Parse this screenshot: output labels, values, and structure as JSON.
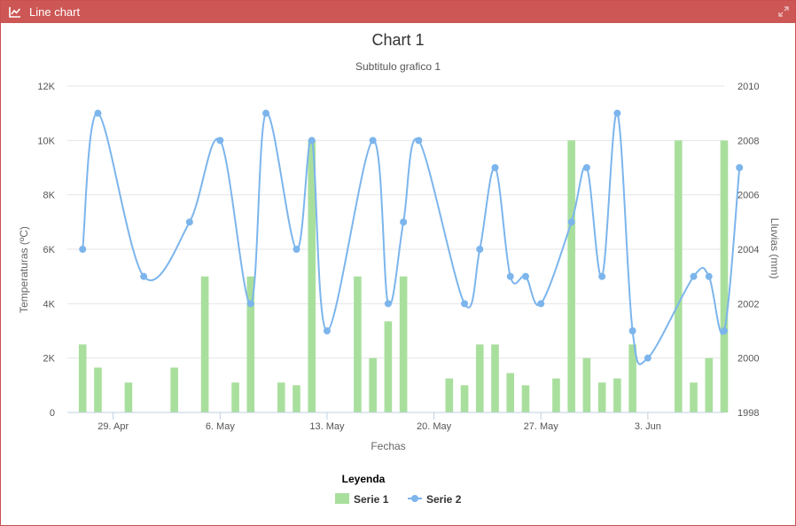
{
  "window": {
    "title": "Line chart",
    "title_icon": "line-chart-icon",
    "expand_icon": "expand-icon",
    "accent": "#cc5755"
  },
  "chart_data": {
    "type": "combo-bar-line",
    "title": "Chart 1",
    "subtitle": "Subtitulo grafico 1",
    "xlabel": "Fechas",
    "ylabel_left": "Temperaturas (ºC)",
    "ylabel_right": "Lluvias (mm)",
    "y_left": {
      "min": 0,
      "max": 12000,
      "ticks": [
        0,
        2000,
        4000,
        6000,
        8000,
        10000,
        12000
      ],
      "tick_labels": [
        "0",
        "2K",
        "4K",
        "6K",
        "8K",
        "10K",
        "12K"
      ]
    },
    "y_right": {
      "min": 1998,
      "max": 2010,
      "ticks": [
        1998,
        2000,
        2002,
        2004,
        2006,
        2008,
        2010
      ],
      "tick_labels": [
        "1998",
        "2000",
        "2002",
        "2004",
        "2006",
        "2008",
        "2010"
      ]
    },
    "x_range": [
      "2024-04-26",
      "2024-06-08"
    ],
    "x_ticks": [
      "2024-04-29",
      "2024-05-06",
      "2024-05-13",
      "2024-05-20",
      "2024-05-27",
      "2024-06-03"
    ],
    "x_tick_labels": [
      "29. Apr",
      "6. May",
      "13. May",
      "20. May",
      "27. May",
      "3. Jun"
    ],
    "grid": true,
    "legend": {
      "title": "Leyenda",
      "position": "bottom-center"
    },
    "series": [
      {
        "name": "Serie 1",
        "kind": "bar",
        "axis": "left",
        "color": "#a9df9d",
        "points": [
          [
            "2024-04-27",
            2500
          ],
          [
            "2024-04-28",
            1650
          ],
          [
            "2024-04-30",
            1100
          ],
          [
            "2024-05-03",
            1650
          ],
          [
            "2024-05-05",
            5000
          ],
          [
            "2024-05-07",
            1100
          ],
          [
            "2024-05-08",
            5000
          ],
          [
            "2024-05-10",
            1100
          ],
          [
            "2024-05-11",
            1000
          ],
          [
            "2024-05-12",
            10000
          ],
          [
            "2024-05-15",
            5000
          ],
          [
            "2024-05-16",
            2000
          ],
          [
            "2024-05-17",
            3350
          ],
          [
            "2024-05-18",
            5000
          ],
          [
            "2024-05-21",
            1250
          ],
          [
            "2024-05-22",
            1000
          ],
          [
            "2024-05-23",
            2500
          ],
          [
            "2024-05-24",
            2500
          ],
          [
            "2024-05-25",
            1450
          ],
          [
            "2024-05-26",
            1000
          ],
          [
            "2024-05-28",
            1250
          ],
          [
            "2024-05-29",
            10000
          ],
          [
            "2024-05-30",
            2000
          ],
          [
            "2024-05-31",
            1100
          ],
          [
            "2024-06-01",
            1250
          ],
          [
            "2024-06-02",
            2500
          ],
          [
            "2024-06-05",
            10000
          ],
          [
            "2024-06-06",
            1100
          ],
          [
            "2024-06-07",
            2000
          ],
          [
            "2024-06-08",
            10000
          ]
        ]
      },
      {
        "name": "Serie 2",
        "kind": "line",
        "axis": "right",
        "color": "#7cb5ec",
        "points": [
          [
            "2024-04-27",
            2004
          ],
          [
            "2024-04-28",
            2009
          ],
          [
            "2024-05-01",
            2003
          ],
          [
            "2024-05-04",
            2005
          ],
          [
            "2024-05-06",
            2008
          ],
          [
            "2024-05-08",
            2002
          ],
          [
            "2024-05-09",
            2009
          ],
          [
            "2024-05-11",
            2004
          ],
          [
            "2024-05-12",
            2008
          ],
          [
            "2024-05-13",
            2001
          ],
          [
            "2024-05-16",
            2008
          ],
          [
            "2024-05-17",
            2002
          ],
          [
            "2024-05-18",
            2005
          ],
          [
            "2024-05-19",
            2008
          ],
          [
            "2024-05-22",
            2002
          ],
          [
            "2024-05-23",
            2004
          ],
          [
            "2024-05-24",
            2007
          ],
          [
            "2024-05-25",
            2003
          ],
          [
            "2024-05-26",
            2003
          ],
          [
            "2024-05-27",
            2002
          ],
          [
            "2024-05-29",
            2005
          ],
          [
            "2024-05-30",
            2007
          ],
          [
            "2024-05-31",
            2003
          ],
          [
            "2024-06-01",
            2009
          ],
          [
            "2024-06-02",
            2001
          ],
          [
            "2024-06-03",
            2000
          ],
          [
            "2024-06-06",
            2003
          ],
          [
            "2024-06-07",
            2003
          ],
          [
            "2024-06-08",
            2001
          ],
          [
            "2024-06-09",
            2007
          ]
        ]
      }
    ]
  }
}
